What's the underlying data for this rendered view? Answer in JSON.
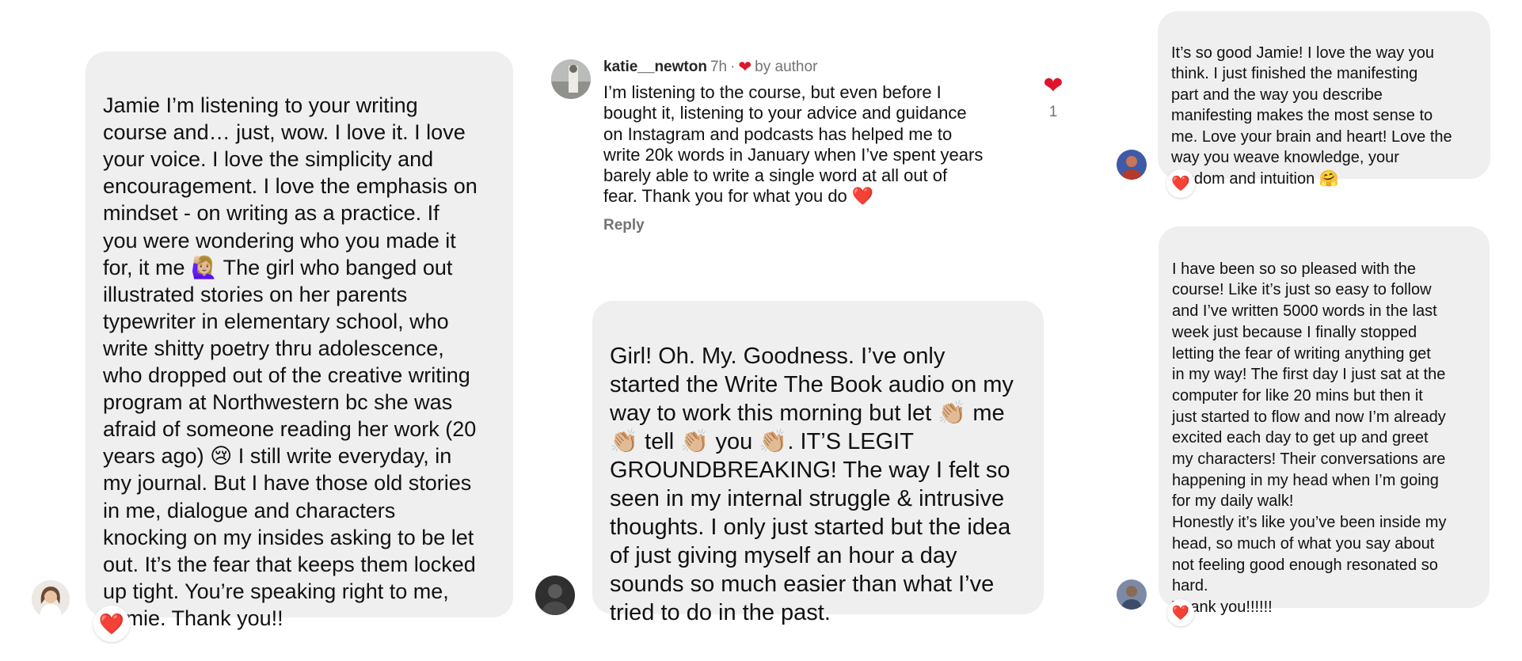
{
  "comments": [
    {
      "text": "Jamie I’m listening to your writing\ncourse and… just, wow. I love it. I love\nyour voice. I love the simplicity and\nencouragement. I love the emphasis on\nmindset - on writing as a practice. If\nyou were wondering who you made it\nfor, it me 🙋🏼‍♀️ The girl who banged out\nillustrated stories on her parents\ntypewriter in elementary school, who\nwrite shitty poetry thru adolescence,\nwho dropped out of the creative writing\nprogram at Northwestern bc she was\nafraid of someone reading her work (20\nyears ago) 😢 I still write everyday, in\nmy journal. But I have those old stories\nin me, dialogue and characters\nknocking on my insides asking to be let\nout. It’s the fear that keeps them locked\nup tight. You’re speaking right to me,\nJamie. Thank you!!",
      "reaction": "❤️"
    },
    {
      "text": "Girl! Oh. My. Goodness. I’ve only\nstarted the Write The Book audio on my\nway to work this morning but let 👏🏼 me\n👏🏼 tell 👏🏼 you 👏🏼. IT’S LEGIT\nGROUNDBREAKING! The way I felt so\nseen in my internal struggle & intrusive\nthoughts. I only just started but the idea\nof just giving myself an hour a day\nsounds so much easier than what I’ve\ntried to do in the past."
    },
    {
      "text": "It’s so good Jamie! I love the way you\nthink. I just finished the manifesting\npart and the way you describe\nmanifesting makes the most sense to\nme. Love your brain and heart! Love the\nway you weave knowledge, your\nwisdom and intuition 🤗",
      "reaction": "❤️"
    },
    {
      "text": "I have been so so pleased with the\ncourse! Like it’s just so easy to follow\nand I’ve written 5000 words in the last\nweek just because I finally stopped\nletting the fear of writing anything get\nin my way! The first day I just sat at the\ncomputer for like 20 mins but then it\njust started to flow and now I’m already\nexcited each day to get up and greet\nmy characters! Their conversations are\nhappening in my head when I’m going\nfor my daily walk!\nHonestly it’s like you’ve been inside my\nhead, so much of what you say about\nnot feeling good enough resonated so\nhard.\nThank you!!!!!!",
      "reaction": "❤️"
    }
  ],
  "thread": {
    "username": "katie__newton",
    "time": "7h",
    "separator": "·",
    "heart": "❤",
    "by_author": "by author",
    "text": "I’m listening to the course, but even before I\nbought it, listening to your advice and guidance\non Instagram and podcasts has helped me to\nwrite 20k words in January when I’ve spent years\nbarely able to write a single word at all out of\nfear. Thank you for what you do ❤️",
    "reply_label": "Reply",
    "like_icon": "❤",
    "like_count": "1"
  },
  "colors": {
    "bubble": "#efefef",
    "like_red": "#e0152b",
    "muted": "#737373"
  }
}
